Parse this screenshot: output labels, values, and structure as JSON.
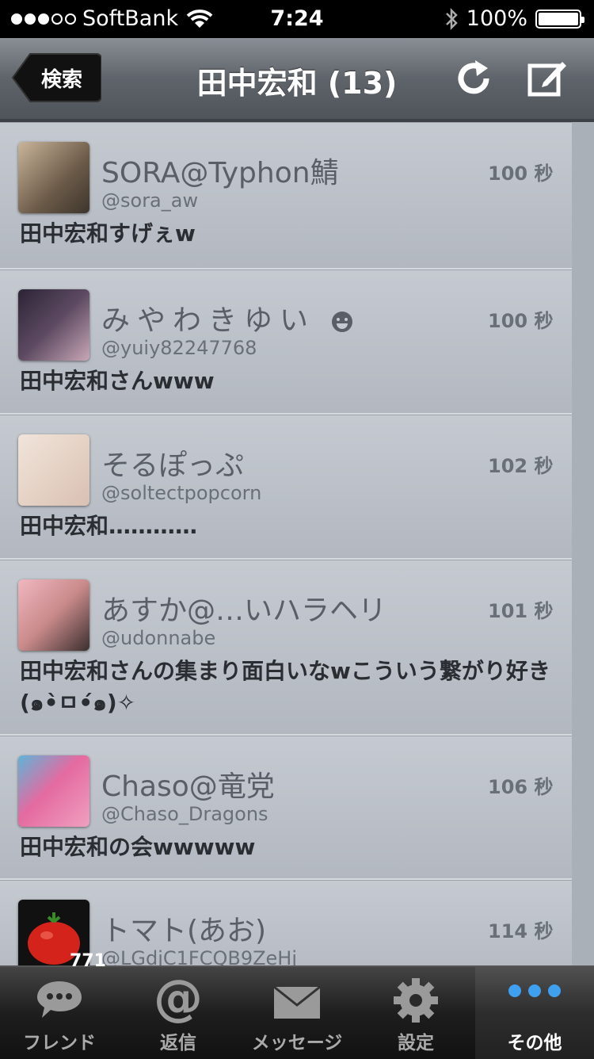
{
  "status_bar": {
    "carrier": "SoftBank",
    "time": "7:24",
    "battery": "100%",
    "signal_bars": 3
  },
  "nav": {
    "back_label": "検索",
    "title": "田中宏和 (13)"
  },
  "feed": [
    {
      "name": "SORA@Typhon鯖",
      "handle": "@sora_aw",
      "age": "100 秒",
      "text": "田中宏和すげぇw",
      "avatar_color": "#8a7b6a"
    },
    {
      "name": "みやわきゆい",
      "handle": "@yuiy82247768",
      "age": "100 秒",
      "text": "田中宏和さんwww",
      "avatar_color": "#3b3142"
    },
    {
      "name": "そるぽっぷ",
      "handle": "@soltectpopcorn",
      "age": "102 秒",
      "text": "田中宏和…………",
      "avatar_color": "#e8d5c8"
    },
    {
      "name": "あすか@…いハラヘリ",
      "handle": "@udonnabe",
      "age": "101 秒",
      "text": "田中宏和さんの集まり面白いなwこういう繋がり好き(๑•̀ㅁ•́๑)✧",
      "avatar_color": "#d9a0a0"
    },
    {
      "name": "Chaso@竜党",
      "handle": "@Chaso_Dragons",
      "age": "106 秒",
      "text": "田中宏和の会wwwww",
      "avatar_color": "#e46aa0"
    },
    {
      "name": "トマト(あお)",
      "handle": "@LGdjC1FCQB9ZeHj",
      "age": "114 秒",
      "text": "",
      "avatar_color": "#111111"
    }
  ],
  "badge": "771",
  "tabs": [
    {
      "label": "フレンド",
      "icon": "speech-bubble-icon"
    },
    {
      "label": "返信",
      "icon": "at-sign-icon"
    },
    {
      "label": "メッセージ",
      "icon": "envelope-icon"
    },
    {
      "label": "設定",
      "icon": "gear-icon"
    },
    {
      "label": "その他",
      "icon": "more-dots-icon"
    }
  ],
  "colors": {
    "accent": "#3fa0f0",
    "nav": "#5f646b"
  }
}
